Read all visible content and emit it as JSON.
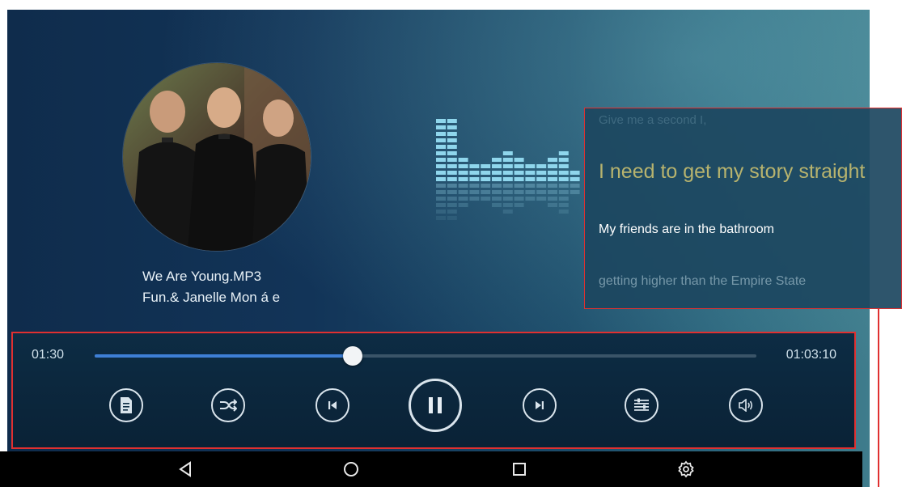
{
  "song": {
    "title": "We Are Young.MP3",
    "artist": "Fun.& Janelle Mon á e",
    "album_art": "album-cover-band-photo"
  },
  "lyrics": {
    "lines": [
      "Give me a second I,",
      "I need to get my story straight",
      "My friends are in the bathroom",
      "getting higher than the Empire State"
    ],
    "current_line_index": 1,
    "current_color": "#b7b36e"
  },
  "equalizer": {
    "icon": "equalizer-visualizer",
    "levels": [
      10,
      10,
      4,
      3,
      3,
      4,
      5,
      4,
      3,
      3,
      4,
      5,
      2
    ]
  },
  "player": {
    "elapsed": "01:30",
    "total": "01:03:10",
    "progress": 0.39,
    "accent": "#3e7fd6",
    "buttons": [
      {
        "name": "playlist",
        "icon": "document-icon"
      },
      {
        "name": "shuffle",
        "icon": "shuffle-icon"
      },
      {
        "name": "previous",
        "icon": "skip-previous-icon"
      },
      {
        "name": "pause",
        "icon": "pause-icon"
      },
      {
        "name": "next",
        "icon": "skip-next-icon"
      },
      {
        "name": "equalizer-settings",
        "icon": "sliders-icon"
      },
      {
        "name": "volume",
        "icon": "volume-icon"
      }
    ]
  },
  "navigation": {
    "icons": [
      "back-icon",
      "home-icon",
      "recents-icon",
      "settings-icon"
    ]
  },
  "colors": {
    "highlight_border": "#e03030",
    "background_dark": "#0f2c4c",
    "background_light": "#3f7c8c"
  }
}
